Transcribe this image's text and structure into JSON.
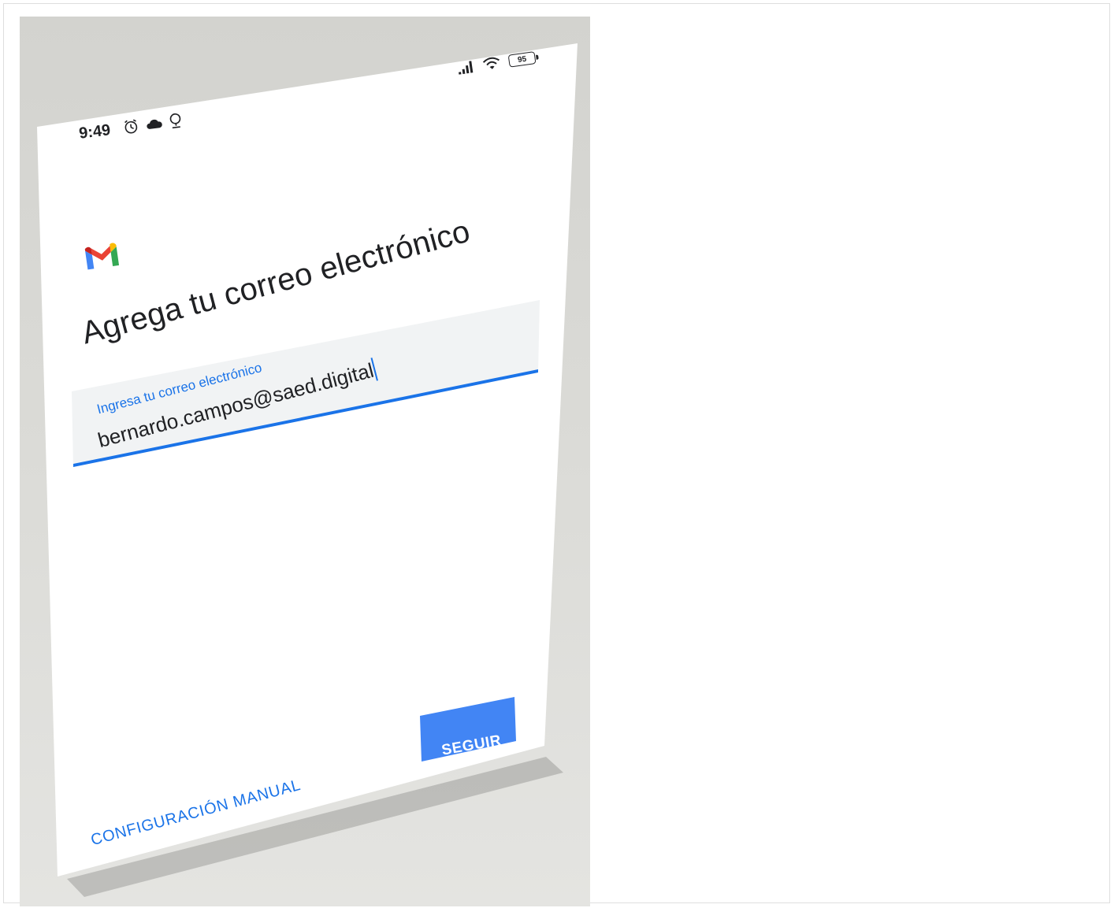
{
  "status_bar": {
    "time": "9:49",
    "battery": "95",
    "left_icons": [
      "alarm-icon",
      "cloud-icon",
      "location-icon"
    ],
    "right_icons": [
      "signal-icon",
      "wifi-icon",
      "battery-icon"
    ]
  },
  "app": {
    "logo": "gmail-logo",
    "title": "Agrega tu correo electrónico"
  },
  "email_field": {
    "label": "Ingresa tu correo electrónico",
    "value": "bernardo.campos@saed.digital"
  },
  "actions": {
    "next_label": "SEGUIR",
    "manual_label": "CONFIGURACIÓN MANUAL"
  },
  "colors": {
    "accent": "#1a73e8",
    "button": "#4285f4",
    "field_bg": "#f1f3f4",
    "text": "#202124"
  }
}
